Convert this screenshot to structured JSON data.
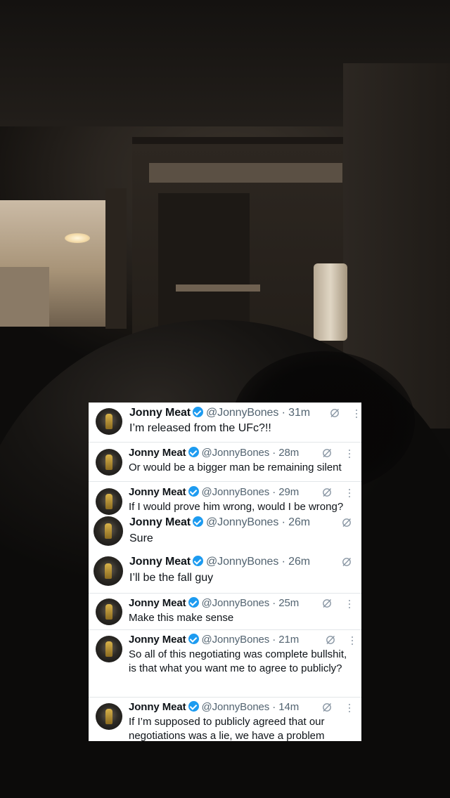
{
  "tweets": [
    {
      "name": "Jonny Meat",
      "handle": "@JonnyBones",
      "time": "31m",
      "text": "I’m released from the UFc?!!"
    },
    {
      "name": "Jonny Meat",
      "handle": "@JonnyBones",
      "time": "28m",
      "text": "Or would be a bigger man be remaining silent"
    },
    {
      "name": "Jonny Meat",
      "handle": "@JonnyBones",
      "time": "29m",
      "text": "If I would prove him wrong, would I be wrong?"
    },
    {
      "name": "Jonny Meat",
      "handle": "@JonnyBones",
      "time": "26m",
      "text": "Sure"
    },
    {
      "name": "Jonny Meat",
      "handle": "@JonnyBones",
      "time": "26m",
      "text": "I’ll be the fall guy"
    },
    {
      "name": "Jonny Meat",
      "handle": "@JonnyBones",
      "time": "25m",
      "text": "Make this make sense"
    },
    {
      "name": "Jonny Meat",
      "handle": "@JonnyBones",
      "time": "21m",
      "text": "So all of this negotiating was complete bullshit, is that what you want me to agree to publicly?"
    },
    {
      "name": "Jonny Meat",
      "handle": "@JonnyBones",
      "time": "14m",
      "text": "If I’m supposed to publicly agreed that our negotiations was a lie, we have a problem"
    }
  ],
  "separator": " · ",
  "icons": {
    "verified": "verified-badge-icon",
    "grok": "grok-slash-icon",
    "more": "more-vertical-icon"
  },
  "colors": {
    "verified": "#1d9bf0",
    "name": "#0f1419",
    "meta": "#536471",
    "panel": "#ffffff"
  }
}
